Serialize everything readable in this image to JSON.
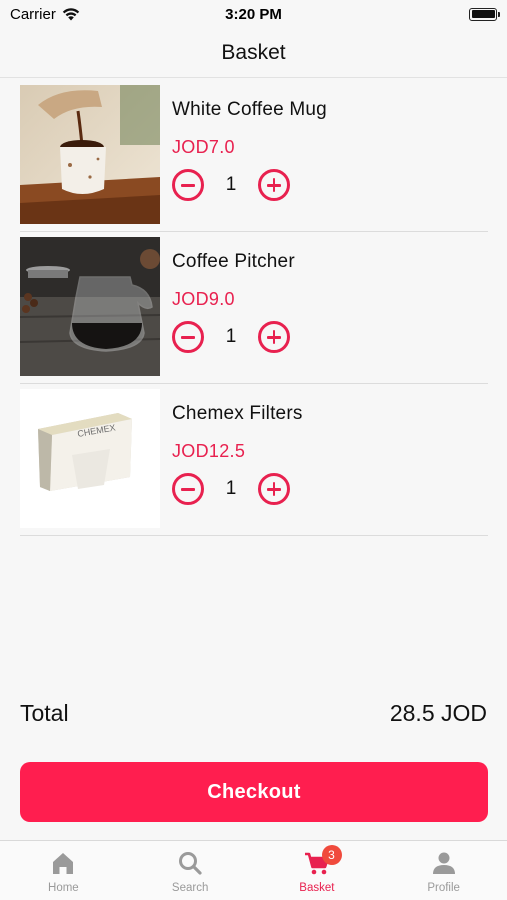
{
  "status_bar": {
    "carrier": "Carrier",
    "time": "3:20 PM"
  },
  "nav": {
    "title": "Basket"
  },
  "items": [
    {
      "name": "White Coffee Mug",
      "price": "JOD7.0",
      "quantity": "1"
    },
    {
      "name": "Coffee Pitcher",
      "price": "JOD9.0",
      "quantity": "1"
    },
    {
      "name": "Chemex Filters",
      "price": "JOD12.5",
      "quantity": "1"
    }
  ],
  "chemex_box_text": "CHEMEX",
  "total": {
    "label": "Total",
    "value": "28.5 JOD"
  },
  "checkout": {
    "label": "Checkout"
  },
  "tabs": [
    {
      "label": "Home",
      "icon": "home-icon"
    },
    {
      "label": "Search",
      "icon": "search-icon"
    },
    {
      "label": "Basket",
      "icon": "cart-icon",
      "badge": "3"
    },
    {
      "label": "Profile",
      "icon": "person-icon"
    }
  ],
  "colors": {
    "accent": "#e8214f",
    "checkout": "#ff1e4f",
    "badge": "#f04a3c",
    "inactive_tab": "#9a9a9a"
  }
}
